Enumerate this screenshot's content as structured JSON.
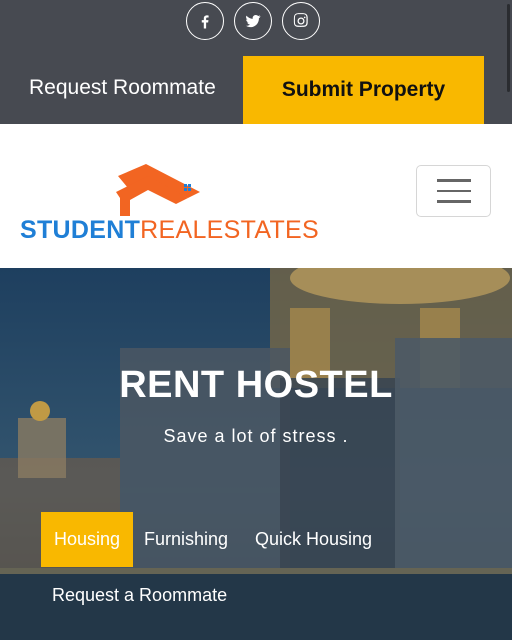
{
  "topbar": {
    "social": [
      "facebook-icon",
      "twitter-icon",
      "instagram-icon"
    ],
    "request_roommate": "Request Roommate",
    "submit_property": "Submit Property"
  },
  "logo": {
    "part1": "STUDENT",
    "part2": "REALESTATES"
  },
  "hero": {
    "title": "RENT HOSTEL",
    "subtitle": "Save a lot of stress .",
    "tabs": [
      "Housing",
      "Furnishing",
      "Quick Housing",
      "Request a Roommate"
    ]
  },
  "colors": {
    "accent": "#f9b800",
    "topbar": "#474a51",
    "logo_blue": "#1f7fd6",
    "logo_orange": "#f26522"
  }
}
